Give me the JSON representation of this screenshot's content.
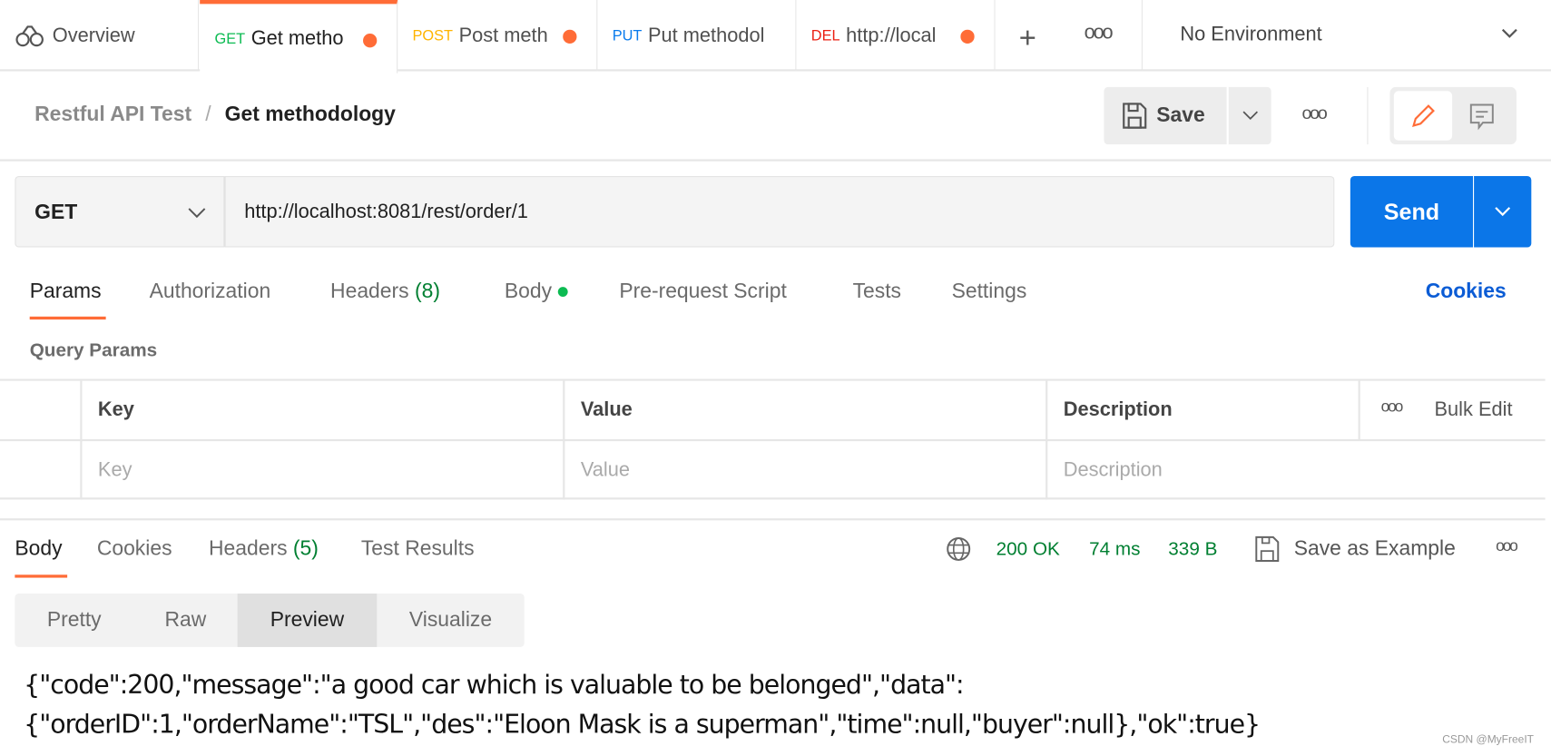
{
  "tabs": {
    "overview": "Overview",
    "items": [
      {
        "method": "GET",
        "label": "Get metho",
        "method_color": "#0cbb52",
        "unsaved": true,
        "active": true
      },
      {
        "method": "POST",
        "label": "Post meth",
        "method_color": "#ffb400",
        "unsaved": true
      },
      {
        "method": "PUT",
        "label": "Put methodol",
        "method_color": "#097bed",
        "unsaved": false
      },
      {
        "method": "DEL",
        "label": "http://local",
        "method_color": "#eb2013",
        "unsaved": true
      }
    ],
    "environment": "No Environment"
  },
  "header": {
    "collection": "Restful API Test",
    "separator": "/",
    "request": "Get methodology",
    "save_label": "Save"
  },
  "request": {
    "method": "GET",
    "url": "http://localhost:8081/rest/order/1",
    "send_label": "Send"
  },
  "request_tabs": {
    "params": "Params",
    "authorization": "Authorization",
    "headers": "Headers",
    "headers_count": "(8)",
    "body": "Body",
    "pre_request": "Pre-request Script",
    "tests": "Tests",
    "settings": "Settings",
    "cookies": "Cookies"
  },
  "query_params": {
    "title": "Query Params",
    "columns": [
      "Key",
      "Value",
      "Description"
    ],
    "bulk_edit": "Bulk Edit",
    "placeholders": [
      "Key",
      "Value",
      "Description"
    ]
  },
  "response": {
    "tabs": {
      "body": "Body",
      "cookies": "Cookies",
      "headers": "Headers",
      "headers_count": "(5)",
      "test_results": "Test Results"
    },
    "status": "200 OK",
    "time": "74 ms",
    "size": "339 B",
    "save_example": "Save as Example",
    "views": [
      "Pretty",
      "Raw",
      "Preview",
      "Visualize"
    ],
    "selected_view": "Preview",
    "body_lines": [
      "{\"code\":200,\"message\":\"a good car which is valuable to be belonged\",\"data\":",
      "{\"orderID\":1,\"orderName\":\"TSL\",\"des\":\"Eloon Mask is a superman\",\"time\":null,\"buyer\":null},\"ok\":true}"
    ]
  },
  "watermark": "CSDN @MyFreeIT",
  "colors": {
    "accent": "#ff6c37",
    "send": "#0b76e8",
    "status_green": "#007f31",
    "link_blue": "#0b5cd5"
  }
}
